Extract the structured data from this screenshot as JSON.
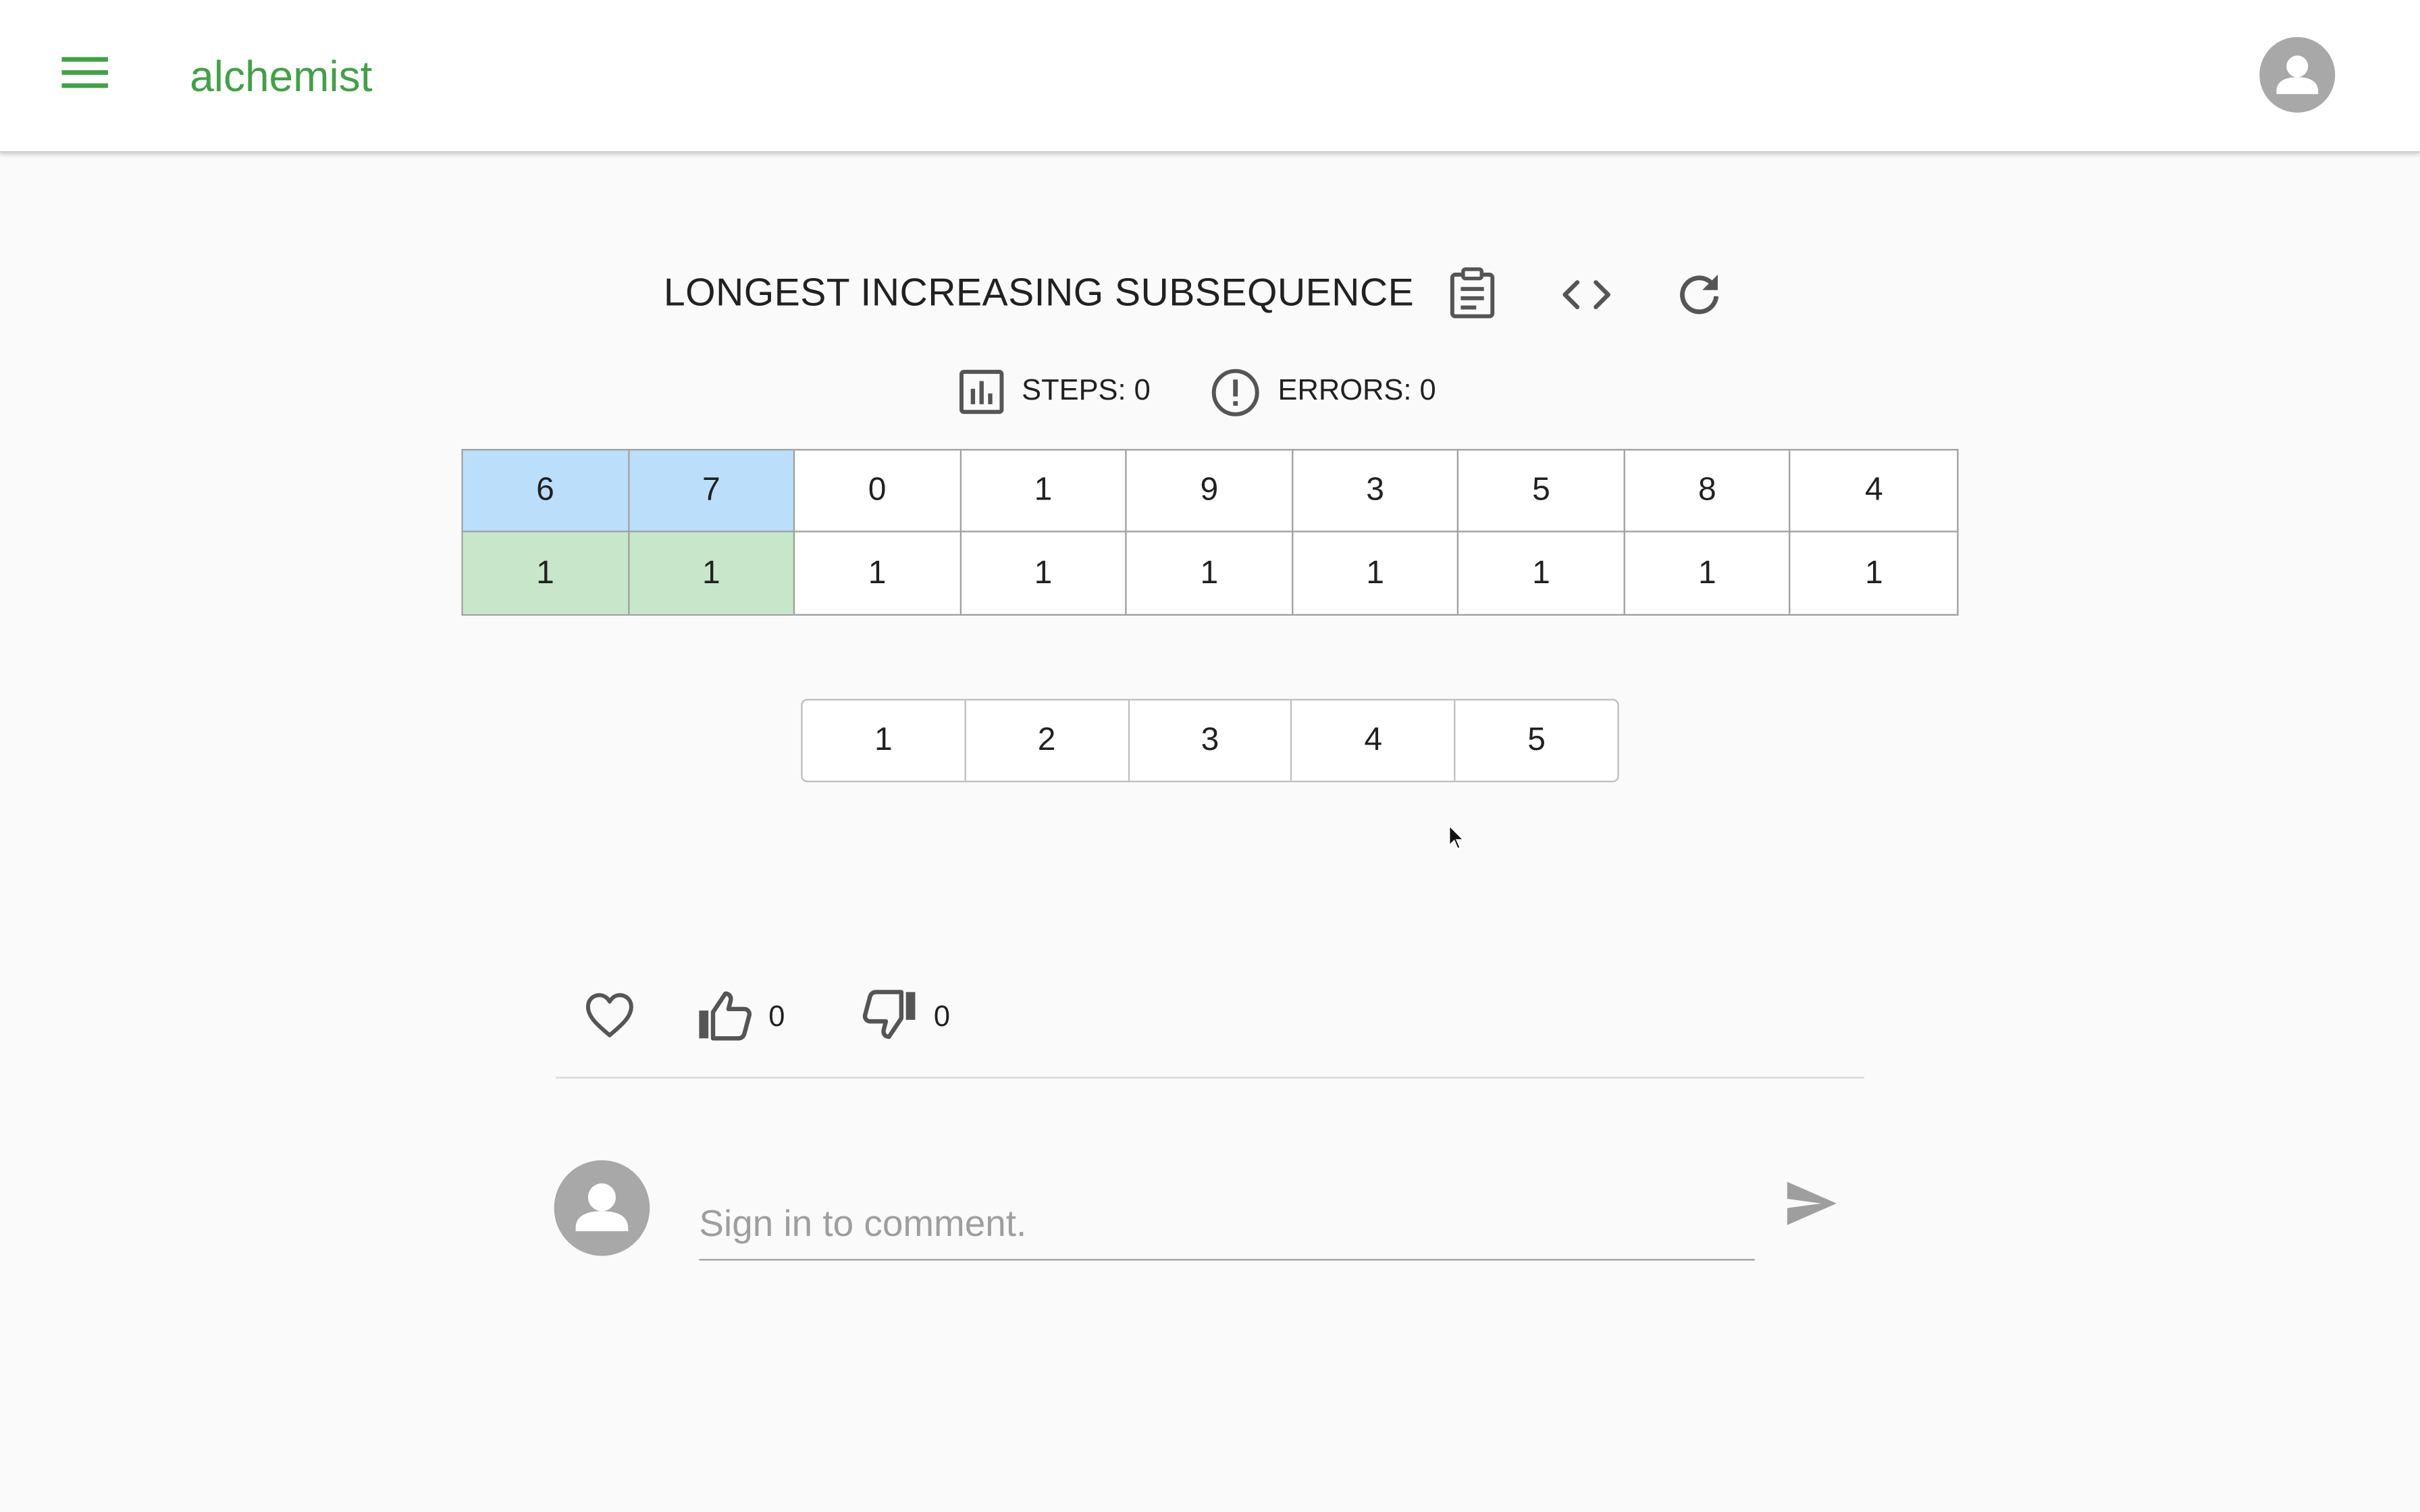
{
  "app": {
    "title": "alchemist",
    "brand_color": "#43a047"
  },
  "page": {
    "title": "LONGEST INCREASING SUBSEQUENCE"
  },
  "toolbar": {
    "icons": [
      "clipboard-icon",
      "code-icon",
      "refresh-icon"
    ]
  },
  "stats": {
    "steps_label": "STEPS: 0",
    "errors_label": "ERRORS: 0"
  },
  "sequence": {
    "values": [
      "6",
      "7",
      "0",
      "1",
      "9",
      "3",
      "5",
      "8",
      "4"
    ],
    "lis_lengths": [
      "1",
      "1",
      "1",
      "1",
      "1",
      "1",
      "1",
      "1",
      "1"
    ],
    "highlight_value_color": "#bbdefb",
    "highlight_length_color": "#c8e6c9"
  },
  "choices": [
    "1",
    "2",
    "3",
    "4",
    "5"
  ],
  "reactions": {
    "likes": "0",
    "dislikes": "0"
  },
  "comment": {
    "placeholder": "Sign in to comment."
  }
}
